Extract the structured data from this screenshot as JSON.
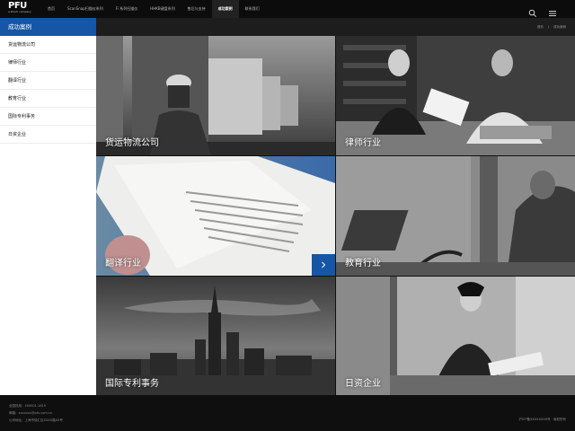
{
  "brand": {
    "logo": "PFU",
    "tagline": "a Ricoh company"
  },
  "nav": {
    "items": [
      "首页",
      "ScanSnap扫描仪系列",
      "Fi 系列扫描仪",
      "HHKB键盘系列",
      "售后与支持",
      "成功案例",
      "联系我们"
    ],
    "active_index": 5,
    "icons": [
      "search-icon",
      "menu-icon"
    ]
  },
  "sidebar": {
    "title": "成功案例",
    "items": [
      "货运物流公司",
      "律师行业",
      "翻译行业",
      "教育行业",
      "国际专利事务",
      "日资企业"
    ]
  },
  "breadcrumb": [
    "首页",
    "/",
    "成功案例"
  ],
  "tiles": [
    {
      "label": "货运物流公司"
    },
    {
      "label": "律师行业"
    },
    {
      "label": "翻译行业",
      "button_icon": "chevron-right-icon"
    },
    {
      "label": "教育行业"
    },
    {
      "label": "国际专利事务"
    },
    {
      "label": "日资企业"
    }
  ],
  "footer": {
    "phone": "全国热线：400001-1819",
    "email": "邮箱：xxxxxxx@pfu.com.cn",
    "address": "公司地址：上海市徐汇区XXXX路XX号",
    "copyright": "沪ICP备XXXXXXXX号 · 版权所有"
  },
  "colors": {
    "accent": "#1756a6",
    "nav_bg": "#0c0c0c",
    "footer_bg": "#0f0f0f"
  }
}
